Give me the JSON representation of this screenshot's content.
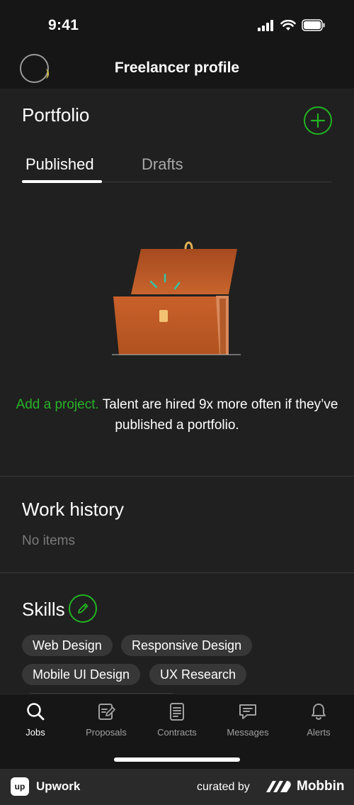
{
  "status_bar": {
    "time": "9:41"
  },
  "header": {
    "title": "Freelancer profile"
  },
  "portfolio": {
    "title": "Portfolio",
    "tabs": [
      {
        "label": "Published"
      },
      {
        "label": "Drafts"
      }
    ],
    "promo_link": "Add a project.",
    "promo_text": " Talent are hired 9x more often if they’ve published a portfolio."
  },
  "work_history": {
    "title": "Work history",
    "empty": "No items"
  },
  "skills": {
    "title": "Skills",
    "items": [
      "Web Design",
      "Responsive Design",
      "Mobile UI Design",
      "UX Research"
    ]
  },
  "tabbar": {
    "items": [
      {
        "label": "Jobs",
        "icon": "search-icon"
      },
      {
        "label": "Proposals",
        "icon": "proposals-icon"
      },
      {
        "label": "Contracts",
        "icon": "contracts-icon"
      },
      {
        "label": "Messages",
        "icon": "messages-icon"
      },
      {
        "label": "Alerts",
        "icon": "bell-icon"
      }
    ]
  },
  "footer": {
    "upwork_logo": "up",
    "upwork": "Upwork",
    "curated_by": "curated by",
    "mobbin": "Mobbin"
  },
  "colors": {
    "accent": "#22b422",
    "background": "#202020",
    "bar": "#161616",
    "chip": "#373737"
  }
}
